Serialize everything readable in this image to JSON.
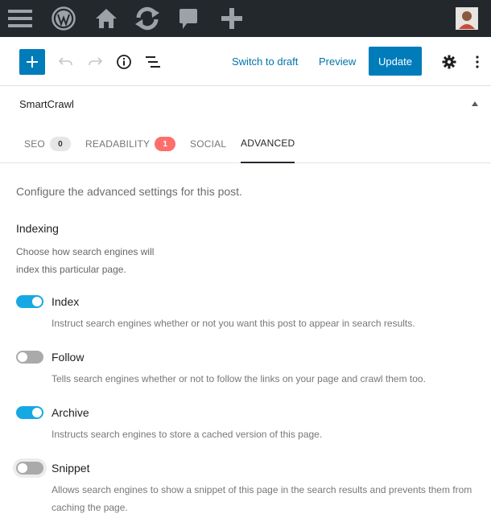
{
  "admin_bar": {
    "icons": [
      "menu-icon",
      "wordpress-logo-icon",
      "home-icon",
      "refresh-icon",
      "comment-icon",
      "plus-icon"
    ]
  },
  "toolbar": {
    "switch_to_draft": "Switch to draft",
    "preview": "Preview",
    "update": "Update"
  },
  "panel": {
    "title": "SmartCrawl"
  },
  "tabs": [
    {
      "label": "SEO",
      "badge": "0"
    },
    {
      "label": "READABILITY",
      "badge": "1"
    },
    {
      "label": "SOCIAL"
    },
    {
      "label": "ADVANCED"
    }
  ],
  "advanced": {
    "intro": "Configure the advanced settings for this post.",
    "indexing_title": "Indexing",
    "indexing_desc": "Choose how search engines will index this particular page.",
    "options": [
      {
        "label": "Index",
        "enabled": true,
        "desc": "Instruct search engines whether or not you want this post to appear in search results."
      },
      {
        "label": "Follow",
        "enabled": false,
        "desc": "Tells search engines whether or not to follow the links on your page and crawl them too."
      },
      {
        "label": "Archive",
        "enabled": true,
        "desc": "Instructs search engines to store a cached version of this page."
      },
      {
        "label": "Snippet",
        "enabled": false,
        "desc": "Allows search engines to show a snippet of this page in the search results and prevents them from caching the page."
      }
    ]
  },
  "colors": {
    "admin_bar_bg": "#23282d",
    "primary": "#007cba",
    "link": "#0073aa",
    "toggle_on": "#17a8e3",
    "toggle_off": "#aaaaaa",
    "badge_red": "#ff6d6d"
  }
}
